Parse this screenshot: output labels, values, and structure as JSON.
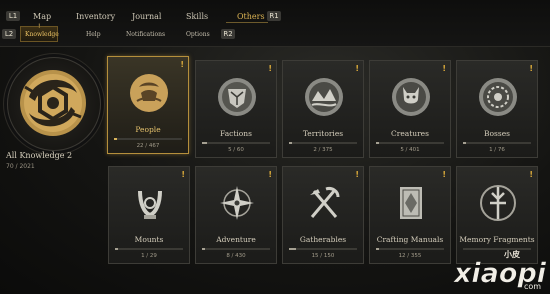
{
  "keys": {
    "left_top": "L1",
    "right_top": "R1",
    "left_sub": "L2",
    "right_sub": "R2"
  },
  "tabs": [
    "Map",
    "Inventory",
    "Journal",
    "Skills",
    "Others"
  ],
  "active_tab": "Others",
  "subtabs": [
    "Knowledge",
    "Help",
    "Notifications",
    "Options"
  ],
  "active_subtab": "Knowledge",
  "subtab_pip": "!",
  "summary": {
    "label": "All Knowledge",
    "badge": "2",
    "count": "70 / 2021"
  },
  "cards": [
    {
      "name": "People",
      "count": "22 / 467",
      "alert": "!",
      "progress": 0.05,
      "icon": "people-medal-icon"
    },
    {
      "name": "Factions",
      "count": "5 / 60",
      "alert": "!",
      "progress": 0.08,
      "icon": "factions-medal-icon"
    },
    {
      "name": "Territories",
      "count": "2 / 375",
      "alert": "!",
      "progress": 0.01,
      "icon": "territories-medal-icon"
    },
    {
      "name": "Creatures",
      "count": "5 / 401",
      "alert": "!",
      "progress": 0.01,
      "icon": "creatures-medal-icon"
    },
    {
      "name": "Bosses",
      "count": "1 / 76",
      "alert": "!",
      "progress": 0.01,
      "icon": "bosses-medal-icon"
    },
    {
      "name": "Mounts",
      "count": "1 / 29",
      "alert": "!",
      "progress": 0.03,
      "icon": "mounts-icon"
    },
    {
      "name": "Adventure",
      "count": "8 / 430",
      "alert": "!",
      "progress": 0.02,
      "icon": "adventure-compass-icon"
    },
    {
      "name": "Gatherables",
      "count": "15 / 150",
      "alert": "!",
      "progress": 0.1,
      "icon": "gatherables-tools-icon"
    },
    {
      "name": "Crafting Manuals",
      "count": "12 / 355",
      "alert": "!",
      "progress": 0.03,
      "icon": "crafting-manual-icon"
    },
    {
      "name": "Memory Fragments",
      "count": "",
      "alert": "!",
      "progress": 0.0,
      "icon": "memory-fragments-icon"
    }
  ],
  "watermark": {
    "top": "小皮",
    "text": "xiaopi",
    "suffix": "com"
  },
  "colors": {
    "accent": "#d9b253",
    "alert": "#d9a93a",
    "panel": "#2a2a27"
  }
}
